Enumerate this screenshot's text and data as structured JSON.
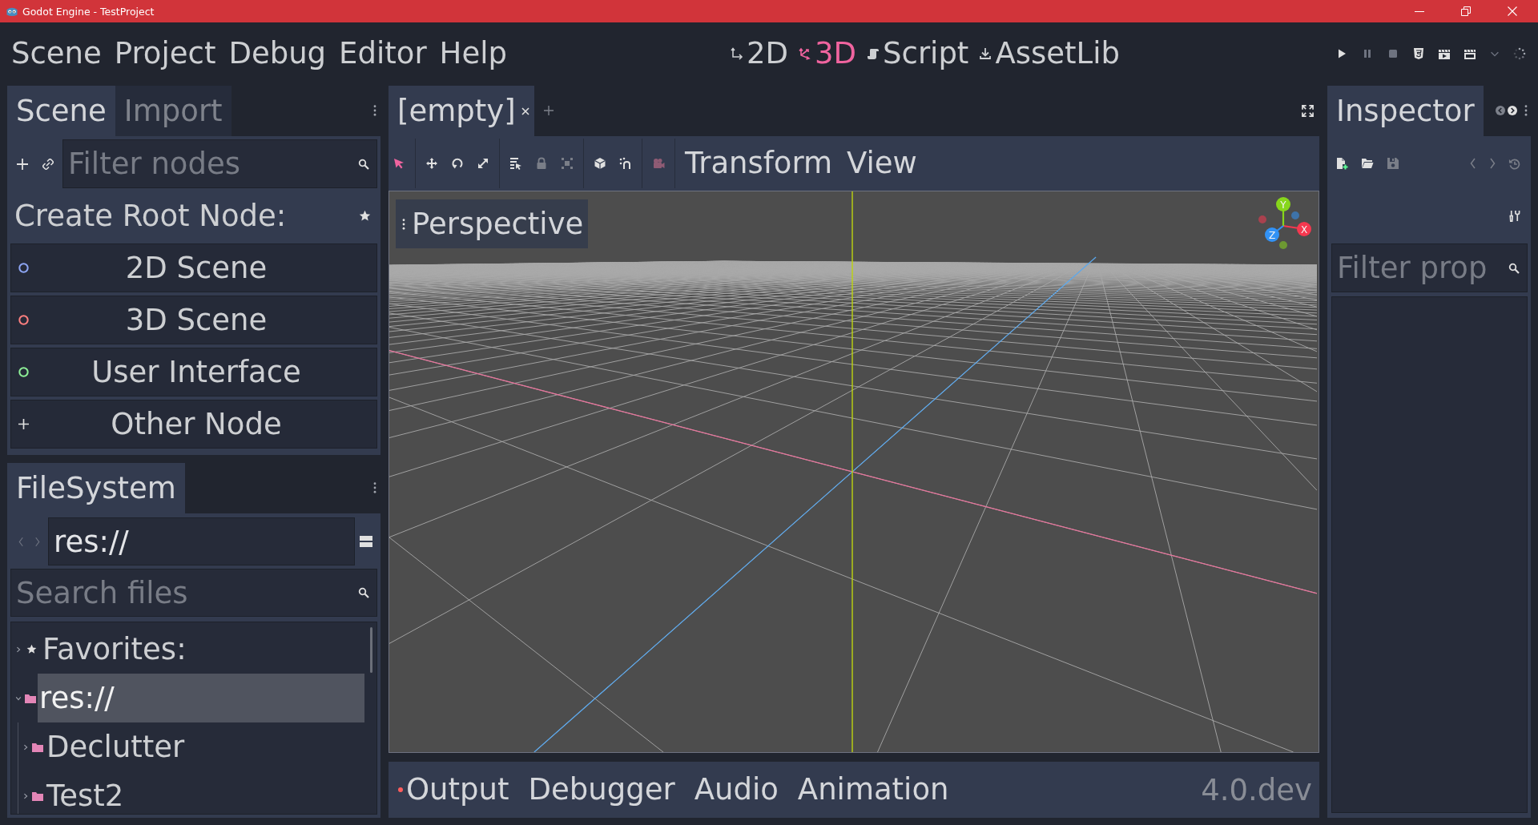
{
  "window": {
    "title": "Godot Engine - TestProject"
  },
  "menu": [
    "Scene",
    "Project",
    "Debug",
    "Editor",
    "Help"
  ],
  "workspaces": [
    {
      "label": "2D",
      "kind": "canvas",
      "selected": false
    },
    {
      "label": "3D",
      "kind": "spatial",
      "selected": true
    },
    {
      "label": "Script",
      "kind": "script",
      "selected": false
    },
    {
      "label": "AssetLib",
      "kind": "assetlib",
      "selected": false
    }
  ],
  "scene_dock": {
    "tabs": [
      {
        "label": "Scene",
        "selected": true
      },
      {
        "label": "Import",
        "selected": false
      }
    ],
    "filter": {
      "placeholder": "Filter nodes"
    },
    "create_root_label": "Create Root Node:",
    "root_options": [
      {
        "label": "2D Scene",
        "kind": "circle",
        "color": "#8da5f3"
      },
      {
        "label": "3D Scene",
        "kind": "circle",
        "color": "#fc7f7f"
      },
      {
        "label": "User Interface",
        "kind": "circle",
        "color": "#8eef97"
      },
      {
        "label": "Other Node",
        "kind": "plus"
      }
    ]
  },
  "filesystem_dock": {
    "tabs": [
      {
        "label": "FileSystem",
        "selected": true
      }
    ],
    "path": {
      "value": "res://"
    },
    "search": {
      "placeholder": "Search files"
    },
    "tree": [
      {
        "label": "Favorites:",
        "kind": "favorites",
        "expanded": false,
        "selected": false
      },
      {
        "label": "res://",
        "kind": "folder",
        "expanded": true,
        "selected": true,
        "children": [
          {
            "label": "Declutter",
            "kind": "folder",
            "expanded": false,
            "selected": false
          },
          {
            "label": "Test2",
            "kind": "folder",
            "expanded": false,
            "selected": false
          }
        ]
      }
    ]
  },
  "scene_tabs": [
    {
      "label": "[empty]",
      "selected": true
    }
  ],
  "toolbar": {
    "modes": [
      {
        "kind": "select",
        "selected": true
      },
      {
        "kind": "move",
        "selected": false
      },
      {
        "kind": "rotate",
        "selected": false
      },
      {
        "kind": "scale",
        "selected": false
      },
      {
        "kind": "listselect",
        "selected": false
      }
    ],
    "actions": [
      {
        "kind": "lock",
        "disabled": true
      },
      {
        "kind": "group",
        "disabled": true
      }
    ],
    "toggles": [
      {
        "kind": "local",
        "on": false
      },
      {
        "kind": "snap",
        "on": false
      }
    ],
    "preview": {
      "disabled": true
    },
    "menus": [
      "Transform",
      "View"
    ]
  },
  "viewport": {
    "view_menu": "Perspective",
    "gizmo": [
      {
        "label": "X",
        "color": "#f5384f"
      },
      {
        "label": "Y",
        "color": "#87d61b"
      },
      {
        "label": "Z",
        "color": "#3292f5"
      }
    ]
  },
  "bottom_panel": {
    "tabs": [
      {
        "label": "Output",
        "selected": false,
        "notify": true
      },
      {
        "label": "Debugger",
        "selected": false,
        "notify": false
      },
      {
        "label": "Audio",
        "selected": false,
        "notify": false
      },
      {
        "label": "Animation",
        "selected": false,
        "notify": false
      }
    ],
    "version": "4.0.dev"
  },
  "inspector": {
    "tabs": [
      {
        "label": "Inspector",
        "selected": true
      }
    ],
    "filter": {
      "placeholder": "Filter prop"
    }
  }
}
